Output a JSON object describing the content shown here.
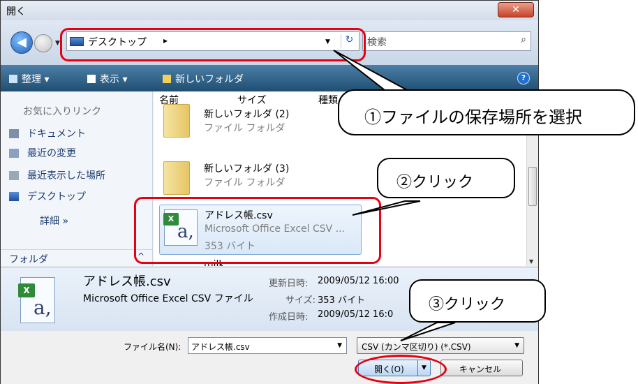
{
  "window": {
    "title": "開く",
    "close_label": "✕"
  },
  "nav": {
    "back_icon": "◀",
    "address_location": "デスクトップ",
    "address_chevron": "▸",
    "dropdown": "▼",
    "refresh_icon": "↻",
    "search_placeholder": "検索",
    "search_icon": "⌕"
  },
  "toolbar": {
    "organize": "整理 ▾",
    "view": "表示 ▾",
    "new_folder": "新しいフォルダ",
    "help": "?"
  },
  "sidebar": {
    "heading": "お気に入りリンク",
    "items": [
      {
        "label": "ドキュメント"
      },
      {
        "label": "最近の変更"
      },
      {
        "label": "最近表示した場所"
      },
      {
        "label": "デスクトップ"
      }
    ],
    "more": "詳細 »",
    "folders_label": "フォルダ",
    "folders_caret": "^"
  },
  "filelist": {
    "columns": [
      "名前",
      "サイズ",
      "種類"
    ],
    "files": [
      {
        "name": "新しいフォルダ (2)",
        "type": "ファイル フォルダ"
      },
      {
        "name": "新しいフォルダ (3)",
        "type": "ファイル フォルダ"
      },
      {
        "name": "アドレス帳.csv",
        "type": "Microsoft Office Excel CSV ...",
        "size": "353 バイト",
        "icon_letter": "a,",
        "badge": "X"
      },
      {
        "name": "milk"
      }
    ]
  },
  "details": {
    "name": "アドレス帳.csv",
    "type": "Microsoft Office Excel CSV ファイル",
    "modified_label": "更新日時:",
    "modified_value": "2009/05/12 16:00",
    "size_label": "サイズ:",
    "size_value": "353 バイト",
    "created_label": "作成日時:",
    "created_value": "2009/05/12 16:0"
  },
  "bottom": {
    "filename_label": "ファイル名(N):",
    "filename_value": "アドレス帳.csv",
    "filetype_value": "CSV (カンマ区切り) (*.CSV)",
    "open_label": "開く(O)",
    "cancel_label": "キャンセル"
  },
  "annotations": {
    "callout1": "①ファイルの保存場所を選択",
    "callout2": "②クリック",
    "callout3": "③クリック",
    "highlight_color": "#e50012"
  }
}
